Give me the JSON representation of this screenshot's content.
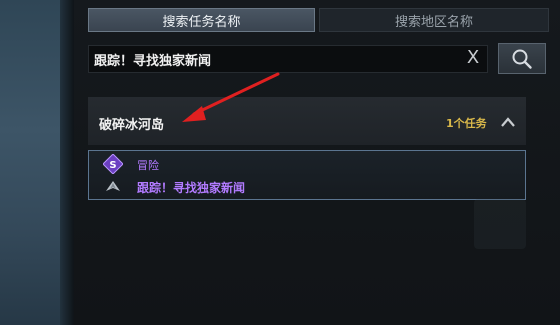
{
  "tabs": {
    "active_label": "搜索任务名称",
    "inactive_label": "搜索地区名称"
  },
  "search": {
    "value": "跟踪！寻找独家新闻",
    "clear_symbol": "X"
  },
  "region": {
    "name": "破碎冰河岛",
    "count": "1个任务"
  },
  "quest": {
    "type": "冒险",
    "title": "跟踪！寻找独家新闻"
  },
  "colors": {
    "quest_purple": "#b27bff",
    "count_gold": "#d9b84a",
    "annotation_red": "#e02020"
  },
  "icons": {
    "search": "search-icon",
    "clear": "close-icon",
    "collapse": "chevron-up-icon",
    "quest_type": "adventure-quest-icon",
    "marker": "quest-marker-icon"
  }
}
